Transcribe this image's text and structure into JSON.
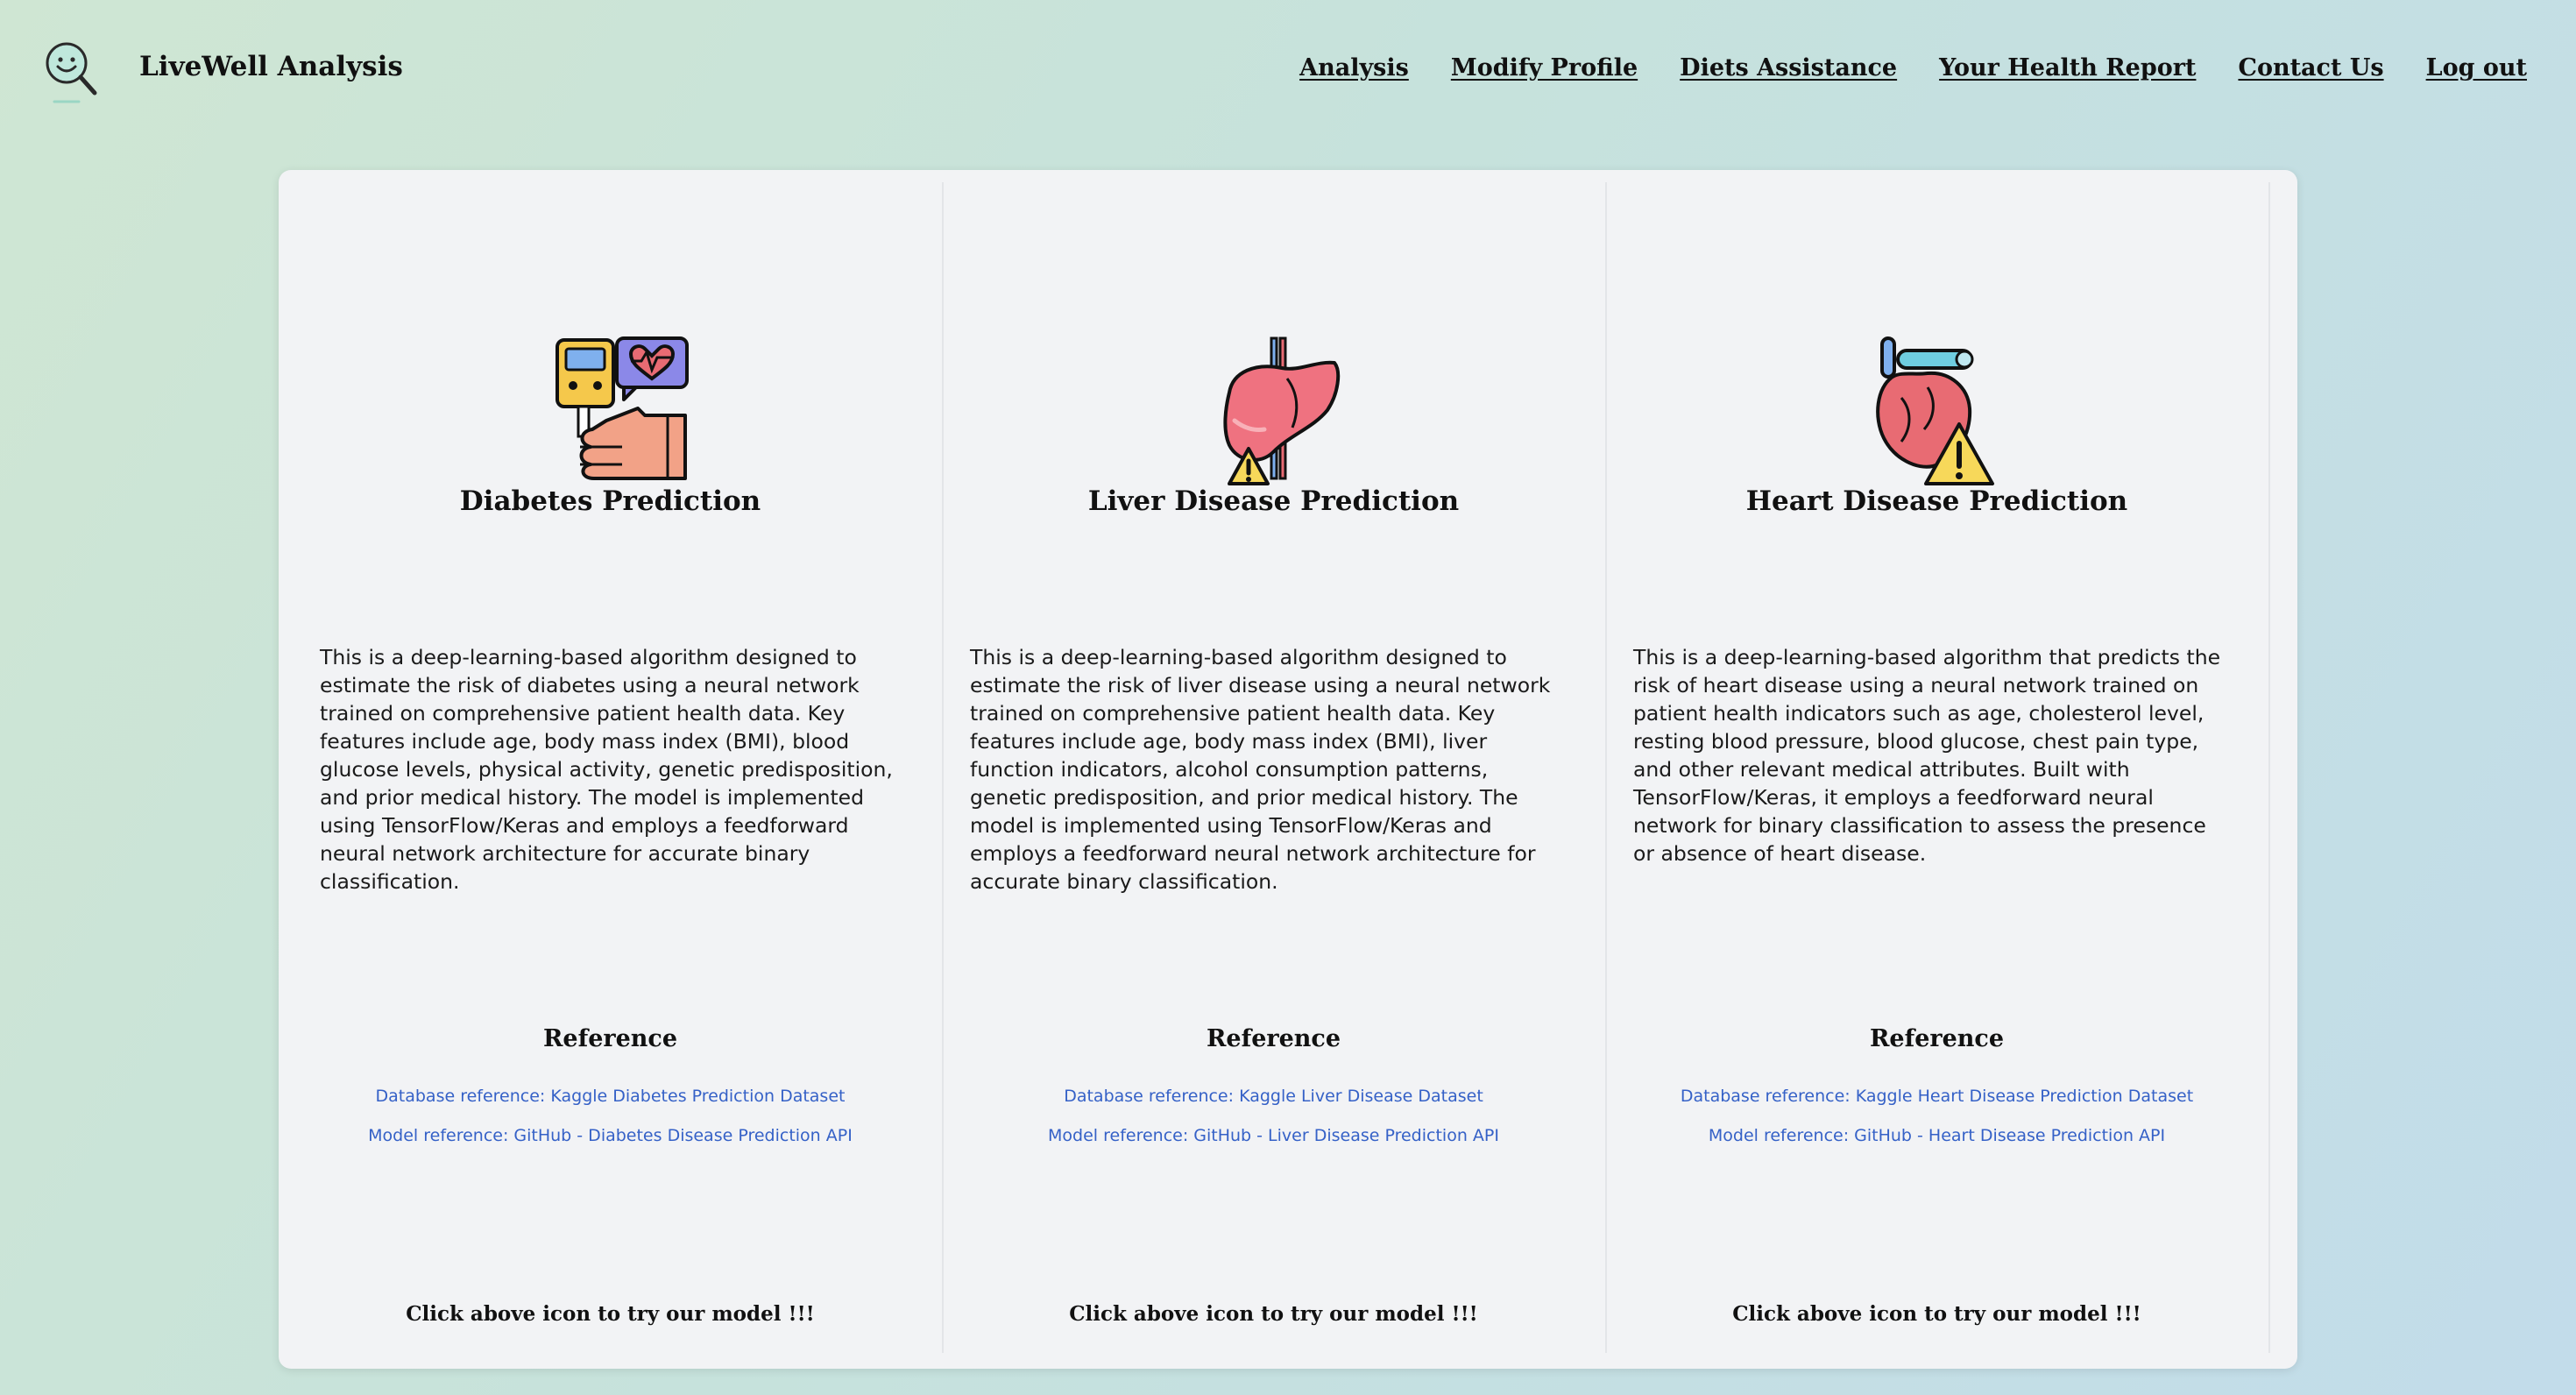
{
  "app": {
    "brand": "LiveWell Analysis"
  },
  "nav": [
    {
      "label": "Analysis"
    },
    {
      "label": "Modify Profile"
    },
    {
      "label": "Diets Assistance"
    },
    {
      "label": "Your Health Report"
    },
    {
      "label": "Contact Us"
    },
    {
      "label": "Log out"
    }
  ],
  "cards": [
    {
      "icon": "glucose-meter-icon",
      "title": "Diabetes Prediction",
      "description": "This is a deep-learning-based algorithm designed to estimate the risk of diabetes using a neural network trained on comprehensive patient health data. Key features include age, body mass index (BMI), blood glucose levels, physical activity, genetic predisposition, and prior medical history. The model is implemented using TensorFlow/Keras and employs a feedforward neural network architecture for accurate binary classification.",
      "reference_title": "Reference",
      "db_ref": "Database reference: Kaggle Diabetes Prediction Dataset",
      "model_ref": "Model reference: GitHub - Diabetes Disease Prediction API",
      "cta": "Click above icon to try our model !!!"
    },
    {
      "icon": "liver-icon",
      "title": "Liver Disease Prediction",
      "description": "This is a deep-learning-based algorithm designed to estimate the risk of liver disease using a neural network trained on comprehensive patient health data. Key features include age, body mass index (BMI), liver function indicators, alcohol consumption patterns, genetic predisposition, and prior medical history. The model is implemented using TensorFlow/Keras and employs a feedforward neural network architecture for accurate binary classification.",
      "reference_title": "Reference",
      "db_ref": "Database reference: Kaggle Liver Disease Dataset",
      "model_ref": "Model reference: GitHub - Liver Disease Prediction API",
      "cta": "Click above icon to try our model !!!"
    },
    {
      "icon": "heart-icon",
      "title": "Heart Disease Prediction",
      "description": "This is a deep-learning-based algorithm that predicts the risk of heart disease using a neural network trained on patient health indicators such as age, cholesterol level, resting blood pressure, blood glucose, chest pain type, and other relevant medical attributes. Built with TensorFlow/Keras, it employs a feedforward neural network for binary classification to assess the presence or absence of heart disease.",
      "reference_title": "Reference",
      "db_ref": "Database reference: Kaggle Heart Disease Prediction Dataset",
      "model_ref": "Model reference: GitHub - Heart Disease Prediction API",
      "cta": "Click above icon to try our model !!!"
    }
  ],
  "colors": {
    "link": "#3561c7",
    "panel": "#f2f3f5",
    "background_start": "#cfe6d3",
    "background_end": "#c2dcea"
  }
}
